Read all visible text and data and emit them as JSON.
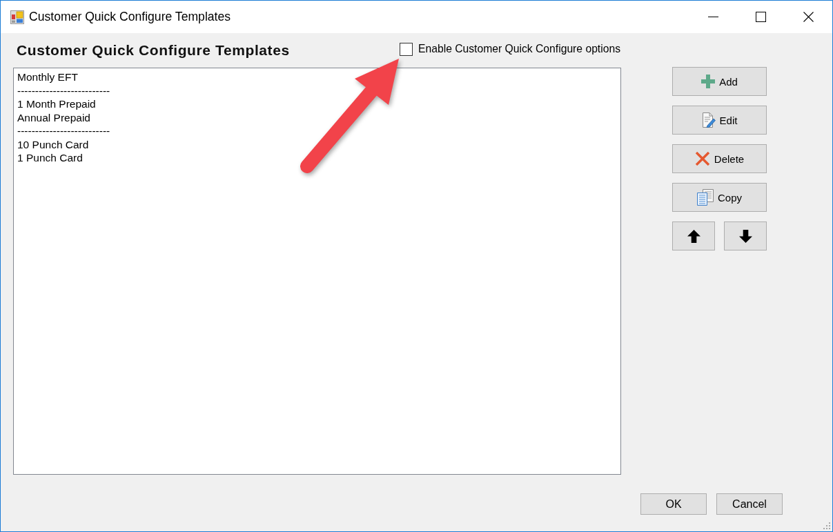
{
  "window": {
    "title": "Customer Quick Configure Templates"
  },
  "heading": "Customer Quick Configure Templates",
  "enable_option": {
    "label": "Enable Customer Quick Configure options",
    "checked": false
  },
  "templates": {
    "items": [
      "Monthly EFT",
      "--------------------------",
      "1 Month Prepaid",
      "Annual Prepaid",
      "--------------------------",
      "10 Punch Card",
      "1 Punch Card"
    ]
  },
  "actions": [
    {
      "kind": "add",
      "label": "Add"
    },
    {
      "kind": "edit",
      "label": "Edit"
    },
    {
      "kind": "delete",
      "label": "Delete"
    },
    {
      "kind": "copy",
      "label": "Copy"
    }
  ],
  "dialog_buttons": [
    "OK",
    "Cancel"
  ]
}
